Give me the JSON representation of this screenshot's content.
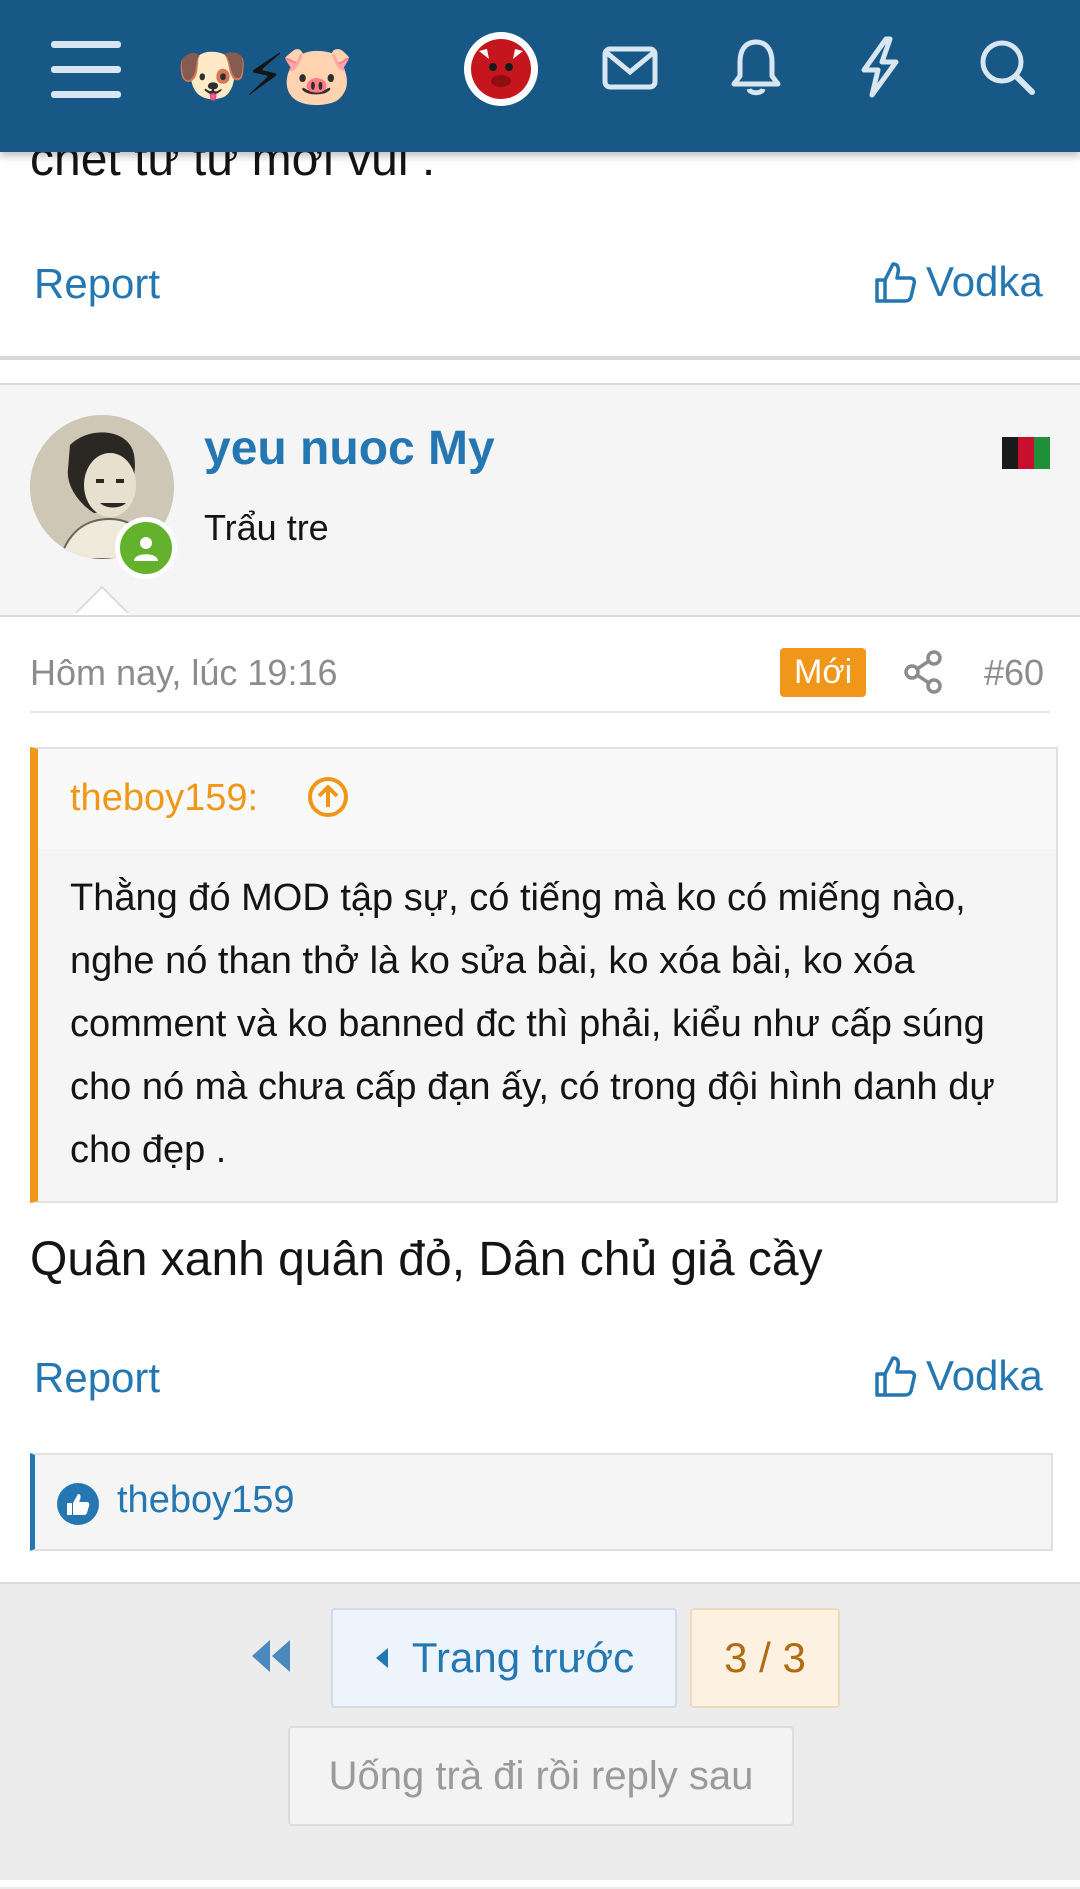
{
  "header": {
    "logo_emoji": "🐶⚡🐷",
    "icons": [
      "menu-icon",
      "avatar",
      "mail-icon",
      "bell-icon",
      "lightning-icon",
      "search-icon"
    ],
    "color": "#185886"
  },
  "prev_post": {
    "text_tail": "chết từ từ mới vui .",
    "report_label": "Report",
    "reaction_label": "Vodka"
  },
  "post": {
    "username": "yeu nuoc My",
    "user_title": "Trẩu tre",
    "date": "Hôm nay, lúc 19:16",
    "new_badge": "Mới",
    "post_number": "#60",
    "quote": {
      "author": "theboy159:",
      "text": "Thằng đó MOD tập sự, có tiếng mà ko có miếng nào, nghe nó than thở là ko sửa bài, ko xóa bài, ko xóa comment và ko banned đc thì phải, kiểu như cấp súng cho nó mà chưa cấp đạn ấy, có trong đội hình danh dự cho đẹp ."
    },
    "body": "Quân xanh quân đỏ, Dân chủ giả cầy",
    "report_label": "Report",
    "reaction_label": "Vodka",
    "liked_by": "theboy159"
  },
  "pager": {
    "prev_label": "Trang trước",
    "page_indicator": "3 / 3",
    "reply_label": "Uống trà đi rồi reply sau"
  },
  "colors": {
    "link": "#2577b1",
    "accent": "#f09719",
    "online": "#63b12c"
  }
}
